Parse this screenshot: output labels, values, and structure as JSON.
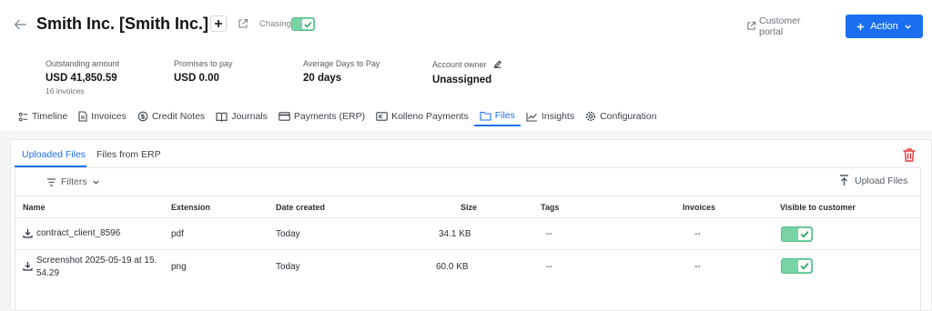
{
  "header": {
    "title": "Smith Inc. [Smith Inc.]",
    "chasing_label": "Chasing",
    "chasing_on": true,
    "customer_portal_label": "Customer portal",
    "action_label": "Action"
  },
  "stats": [
    {
      "label": "Outstanding amount",
      "value": "USD 41,850.59",
      "sub": "16 invoices"
    },
    {
      "label": "Promises to pay",
      "value": "USD 0.00",
      "sub": ""
    },
    {
      "label": "Average Days to Pay",
      "value": "20 days",
      "sub": ""
    },
    {
      "label": "Account owner",
      "value": "Unassigned",
      "sub": ""
    }
  ],
  "tabs": [
    {
      "label": "Timeline",
      "icon": "timeline-icon"
    },
    {
      "label": "Invoices",
      "icon": "invoice-icon"
    },
    {
      "label": "Credit Notes",
      "icon": "credit-note-icon"
    },
    {
      "label": "Journals",
      "icon": "book-icon"
    },
    {
      "label": "Payments (ERP)",
      "icon": "card-icon"
    },
    {
      "label": "Kolleno Payments",
      "icon": "kolleno-payments-icon"
    },
    {
      "label": "Files",
      "icon": "folder-icon",
      "active": true
    },
    {
      "label": "Insights",
      "icon": "chart-icon"
    },
    {
      "label": "Configuration",
      "icon": "gear-icon"
    }
  ],
  "files": {
    "subtabs": [
      "Uploaded Files",
      "Files from ERP"
    ],
    "filters_label": "Filters",
    "upload_label": "Upload Files",
    "columns": [
      "Name",
      "Extension",
      "Date created",
      "Size",
      "Tags",
      "Invoices",
      "Visible to customer"
    ],
    "rows": [
      {
        "name": "contract_client_8596",
        "name2": "",
        "extension": "pdf",
        "date": "Today",
        "size": "34.1 KB",
        "tags": "--",
        "invoices": "--",
        "visible": true
      },
      {
        "name": "Screenshot 2025-05-19 at 15.",
        "name2": "54.29",
        "extension": "png",
        "date": "Today",
        "size": "60.0 KB",
        "tags": "--",
        "invoices": "--",
        "visible": true
      }
    ]
  },
  "colors": {
    "accent": "#1a6ff0",
    "toggle_on": "#79d3a4",
    "danger": "#e03a3a"
  }
}
